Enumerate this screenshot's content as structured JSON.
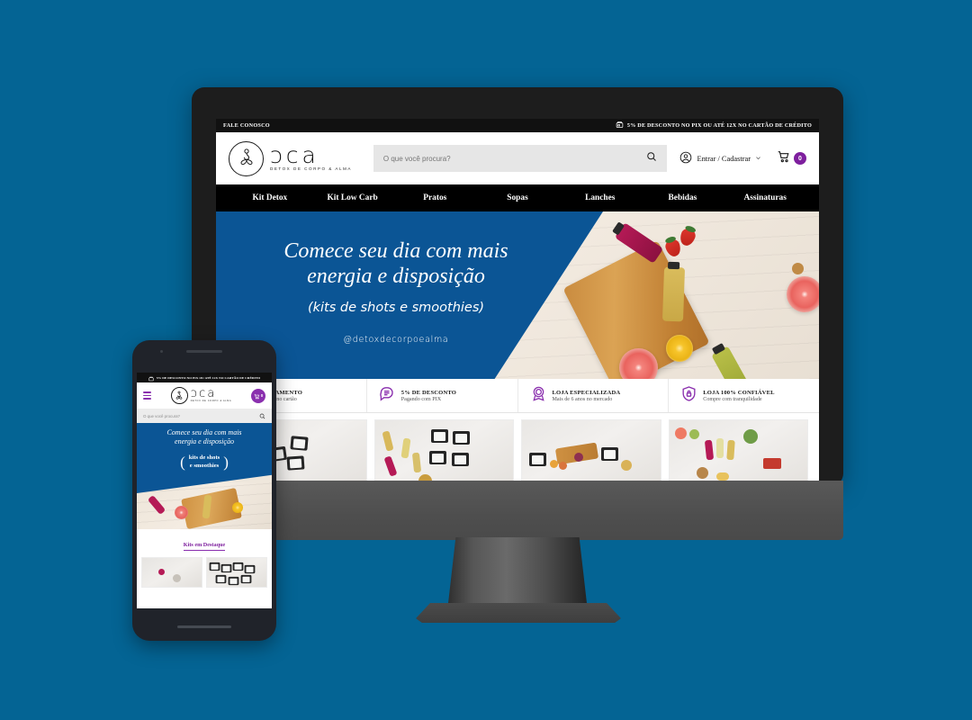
{
  "background_color": "#046494",
  "accent_purple": "#7e1f9e",
  "hero_blue": "#0b5595",
  "desktop": {
    "topbar": {
      "contact_label": "FALE CONOSCO",
      "promo_text": "5% DE DESCONTO NO PIX OU ATÉ 12X NO CARTÃO DE CRÉDITO",
      "promo_icon": "card-machine-icon"
    },
    "header": {
      "brand_word": "ɔca",
      "brand_tagline": "DETOX DE CORPO & ALMA",
      "search_placeholder": "O que você procura?",
      "search_value": "",
      "search_icon": "search-icon",
      "account_label": "Entrar / Cadastrar",
      "account_icon": "user-circle-icon",
      "cart_icon": "shopping-cart-icon",
      "cart_count": "0"
    },
    "nav": [
      {
        "label": "Kit Detox"
      },
      {
        "label": "Kit Low Carb"
      },
      {
        "label": "Pratos"
      },
      {
        "label": "Sopas"
      },
      {
        "label": "Lanches"
      },
      {
        "label": "Bebidas"
      },
      {
        "label": "Assinaturas"
      }
    ],
    "hero": {
      "title_line1": "Comece seu dia com mais",
      "title_line2": "energia e disposição",
      "subtitle": "(kits de shots e smoothies)",
      "handle": "@detoxdecorpoealma"
    },
    "benefits": [
      {
        "icon": "credit-card-icon",
        "title": "PARCELAMENTO",
        "subtitle": "Em até 12x no cartão"
      },
      {
        "icon": "chat-discount-icon",
        "title": "5% DE DESCONTO",
        "subtitle": "Pagando com PIX"
      },
      {
        "icon": "badge-star-icon",
        "title": "LOJA ESPECIALIZADA",
        "subtitle": "Mais de 6 anos no mercado"
      },
      {
        "icon": "shield-lock-icon",
        "title": "LOJA 100% CONFIÁVEL",
        "subtitle": "Compre com tranquilidade"
      }
    ],
    "products": [
      {
        "name": "product-card-1"
      },
      {
        "name": "product-card-2"
      },
      {
        "name": "product-card-3"
      },
      {
        "name": "product-card-4"
      }
    ]
  },
  "phone": {
    "topbar": {
      "promo_text": "5% DE DESCONTO NO PIX OU ATÉ 12X NO CARTÃO DE CRÉDITO",
      "promo_icon": "card-machine-icon"
    },
    "header": {
      "menu_icon": "hamburger-menu-icon",
      "brand_word": "ɔca",
      "brand_tagline": "DETOX DE CORPO & ALMA",
      "cart_icon": "shopping-cart-icon",
      "cart_count": "0"
    },
    "search_placeholder": "O que você procura?",
    "search_icon": "search-icon",
    "hero": {
      "title_line1": "Comece seu dia com mais",
      "title_line2": "energia e disposição",
      "sub_line1": "kits de shots",
      "sub_line2": "e smoothies",
      "brace_left": "(",
      "brace_right": ")"
    },
    "section_title": "Kits em Destaque"
  }
}
